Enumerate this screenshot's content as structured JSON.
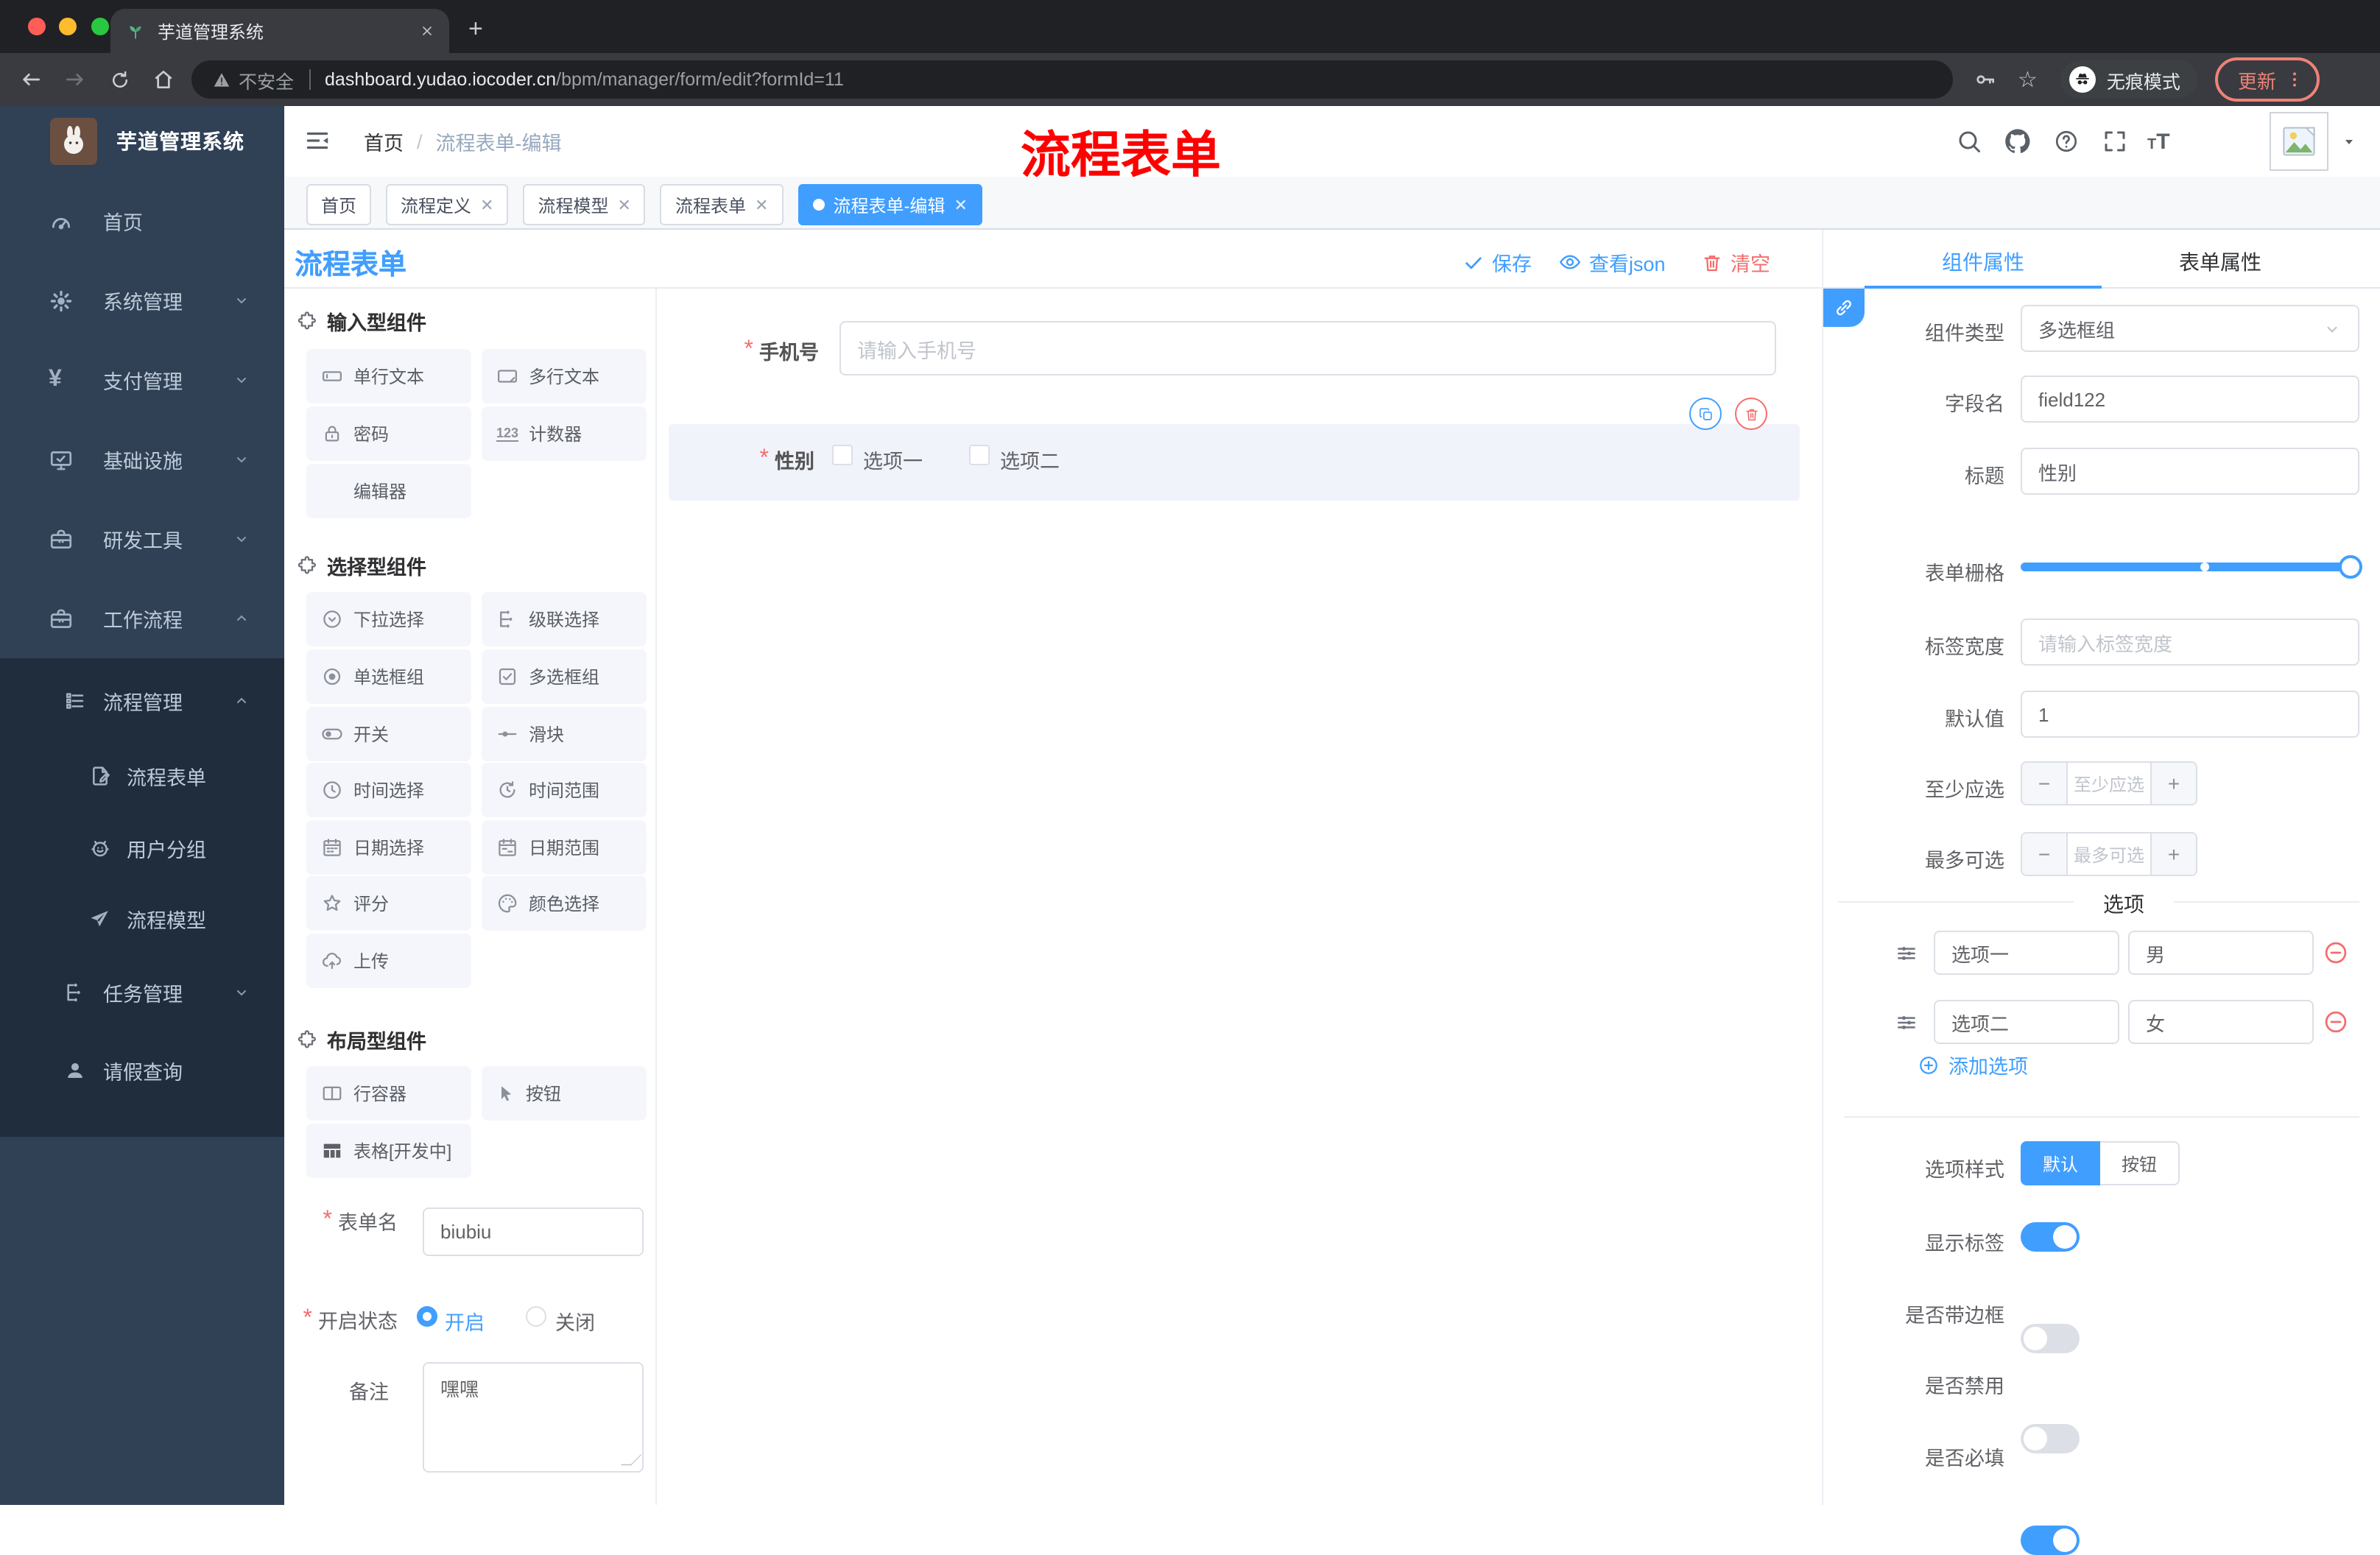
{
  "browser": {
    "tab_title": "芋道管理系统",
    "security_label": "不安全",
    "url_host": "dashboard.yudao.iocoder.cn",
    "url_path": "/bpm/manager/form/edit?formId=11",
    "incognito_label": "无痕模式",
    "update_label": "更新"
  },
  "sidebar": {
    "brand": "芋道管理系统",
    "items": [
      {
        "label": "首页"
      },
      {
        "label": "系统管理"
      },
      {
        "label": "支付管理"
      },
      {
        "label": "基础设施"
      },
      {
        "label": "研发工具"
      },
      {
        "label": "工作流程"
      }
    ],
    "submenu": [
      {
        "label": "流程管理"
      },
      {
        "label": "流程表单"
      },
      {
        "label": "用户分组"
      },
      {
        "label": "流程模型"
      },
      {
        "label": "任务管理"
      },
      {
        "label": "请假查询"
      }
    ]
  },
  "header": {
    "breadcrumb_home": "首页",
    "breadcrumb_sep": "/",
    "breadcrumb_current": "流程表单-编辑",
    "annotation": "流程表单"
  },
  "tabstrip": {
    "tabs": [
      "首页",
      "流程定义",
      "流程模型",
      "流程表单",
      "流程表单-编辑"
    ]
  },
  "designer": {
    "title": "流程表单",
    "toolbar": {
      "save": "保存",
      "view_json": "查看json",
      "clear": "清空"
    },
    "palette": {
      "sections": [
        {
          "title": "输入型组件",
          "items": [
            "单行文本",
            "多行文本",
            "密码",
            "计数器",
            "编辑器"
          ]
        },
        {
          "title": "选择型组件",
          "items": [
            "下拉选择",
            "级联选择",
            "单选框组",
            "多选框组",
            "开关",
            "滑块",
            "时间选择",
            "时间范围",
            "日期选择",
            "日期范围",
            "评分",
            "颜色选择",
            "上传"
          ]
        },
        {
          "title": "布局型组件",
          "items": [
            "行容器",
            "按钮",
            "表格[开发中]"
          ]
        }
      ]
    },
    "canvas": {
      "phone": {
        "label": "手机号",
        "placeholder": "请输入手机号"
      },
      "gender": {
        "label": "性别",
        "options": [
          "选项一",
          "选项二"
        ]
      }
    },
    "meta": {
      "form_name_label": "表单名",
      "form_name_value": "biubiu",
      "status_label": "开启状态",
      "status_on": "开启",
      "status_off": "关闭",
      "remark_label": "备注",
      "remark_value": "嘿嘿"
    }
  },
  "panel": {
    "tabs": [
      "组件属性",
      "表单属性"
    ],
    "fields": {
      "type_label": "组件类型",
      "type_value": "多选框组",
      "name_label": "字段名",
      "name_value": "field122",
      "title_label": "标题",
      "title_value": "性别",
      "grid_label": "表单栅格",
      "labelwidth_label": "标签宽度",
      "labelwidth_placeholder": "请输入标签宽度",
      "default_label": "默认值",
      "default_value": "1",
      "min_label": "至少应选",
      "min_placeholder": "至少应选",
      "max_label": "最多可选",
      "max_placeholder": "最多可选"
    },
    "options": {
      "title": "选项",
      "rows": [
        {
          "label": "选项一",
          "value": "男"
        },
        {
          "label": "选项二",
          "value": "女"
        }
      ],
      "add": "添加选项"
    },
    "style": {
      "label": "选项样式",
      "default": "默认",
      "button": "按钮"
    },
    "toggles": [
      {
        "label": "显示标签",
        "state": "on"
      },
      {
        "label": "是否带边框",
        "state": "off"
      },
      {
        "label": "是否禁用",
        "state": "off"
      },
      {
        "label": "是否必填",
        "state": "on"
      }
    ]
  },
  "colors": {
    "accent": "#409eff",
    "danger": "#f56c6c",
    "sidebar": "#304156",
    "submenu": "#1f2d3d",
    "annotation": "#ff0000"
  }
}
